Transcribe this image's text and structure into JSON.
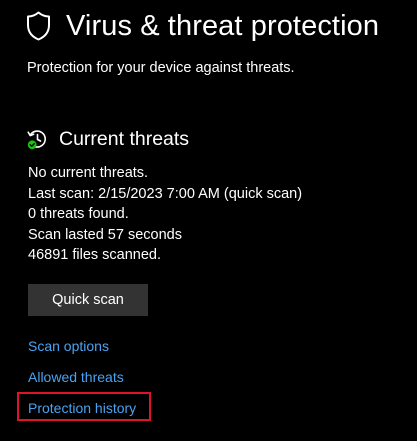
{
  "header": {
    "title": "Virus & threat protection",
    "subtitle": "Protection for your device against threats.",
    "icon": "shield-icon"
  },
  "current_threats": {
    "title": "Current threats",
    "icon": "clock-refresh-check-icon",
    "status_lines": [
      "No current threats.",
      "Last scan: 2/15/2023 7:00 AM (quick scan)",
      "0 threats found.",
      "Scan lasted 57 seconds",
      "46891 files scanned."
    ],
    "quick_scan_label": "Quick scan"
  },
  "links": {
    "scan_options": "Scan options",
    "allowed_threats": "Allowed threats",
    "protection_history": "Protection history"
  },
  "colors": {
    "background": "#000000",
    "text": "#ffffff",
    "link": "#4aa3f0",
    "button": "#333333",
    "check_badge": "#16c60c",
    "highlight": "#e0112b"
  }
}
